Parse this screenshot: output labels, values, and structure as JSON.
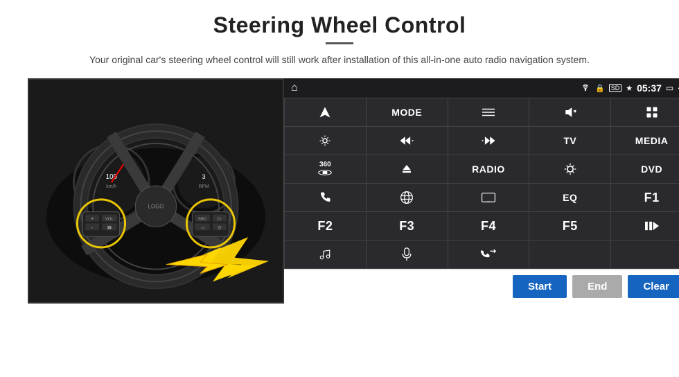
{
  "header": {
    "title": "Steering Wheel Control",
    "subtitle": "Your original car's steering wheel control will still work after installation of this all-in-one auto radio navigation system.",
    "divider": true
  },
  "status_bar": {
    "home_icon": "⌂",
    "wifi_icon": "wifi",
    "lock_icon": "lock",
    "sd_icon": "sd",
    "bt_icon": "bt",
    "time": "05:37",
    "screen_icon": "screen",
    "back_icon": "back"
  },
  "grid": [
    {
      "id": "r0c0",
      "type": "icon",
      "label": "navigate"
    },
    {
      "id": "r0c1",
      "type": "text",
      "label": "MODE"
    },
    {
      "id": "r0c2",
      "type": "icon",
      "label": "list"
    },
    {
      "id": "r0c3",
      "type": "icon",
      "label": "mute"
    },
    {
      "id": "r0c4",
      "type": "icon",
      "label": "apps"
    },
    {
      "id": "r1c0",
      "type": "icon",
      "label": "settings"
    },
    {
      "id": "r1c1",
      "type": "icon",
      "label": "prev"
    },
    {
      "id": "r1c2",
      "type": "icon",
      "label": "next"
    },
    {
      "id": "r1c3",
      "type": "text",
      "label": "TV"
    },
    {
      "id": "r1c4",
      "type": "text",
      "label": "MEDIA"
    },
    {
      "id": "r2c0",
      "type": "icon",
      "label": "360cam"
    },
    {
      "id": "r2c1",
      "type": "icon",
      "label": "eject"
    },
    {
      "id": "r2c2",
      "type": "text",
      "label": "RADIO"
    },
    {
      "id": "r2c3",
      "type": "icon",
      "label": "brightness"
    },
    {
      "id": "r2c4",
      "type": "text",
      "label": "DVD"
    },
    {
      "id": "r3c0",
      "type": "icon",
      "label": "phone"
    },
    {
      "id": "r3c1",
      "type": "icon",
      "label": "internet"
    },
    {
      "id": "r3c2",
      "type": "icon",
      "label": "display"
    },
    {
      "id": "r3c3",
      "type": "text",
      "label": "EQ"
    },
    {
      "id": "r3c4",
      "type": "text",
      "label": "F1"
    },
    {
      "id": "r4c0",
      "type": "text",
      "label": "F2"
    },
    {
      "id": "r4c1",
      "type": "text",
      "label": "F3"
    },
    {
      "id": "r4c2",
      "type": "text",
      "label": "F4"
    },
    {
      "id": "r4c3",
      "type": "text",
      "label": "F5"
    },
    {
      "id": "r4c4",
      "type": "icon",
      "label": "play-pause"
    },
    {
      "id": "r5c0",
      "type": "icon",
      "label": "music"
    },
    {
      "id": "r5c1",
      "type": "icon",
      "label": "mic"
    },
    {
      "id": "r5c2",
      "type": "icon",
      "label": "answer"
    },
    {
      "id": "r5c3",
      "type": "empty",
      "label": ""
    },
    {
      "id": "r5c4",
      "type": "empty",
      "label": ""
    }
  ],
  "bottom_buttons": {
    "start": "Start",
    "end": "End",
    "clear": "Clear"
  }
}
